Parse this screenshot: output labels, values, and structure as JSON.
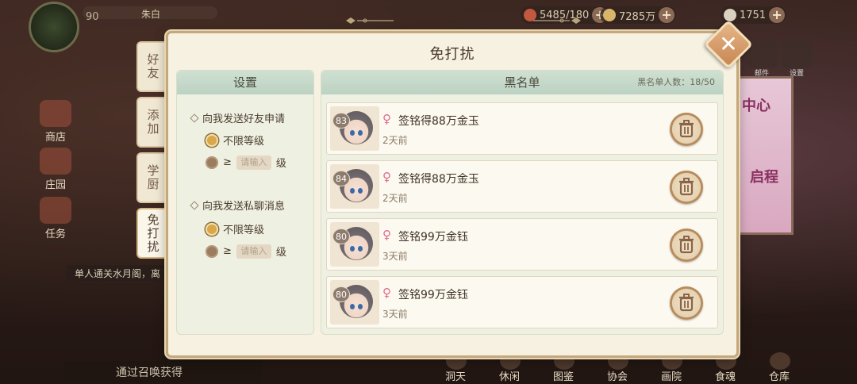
{
  "hud": {
    "player_level": "90",
    "player_name": "朱白",
    "stamina": "5485/180",
    "gold": "7285万",
    "gems": "1751",
    "side_menu": [
      "商店",
      "庄园",
      "任务"
    ],
    "right_menu": [
      "邮件",
      "设置"
    ],
    "poster_text": [
      "中心",
      "启程"
    ],
    "chat_line": "单人通关水月阁，离",
    "recruit_text": "通过召唤获得",
    "bottom_nav": [
      "洞天",
      "休闲",
      "图鉴",
      "协会",
      "画院",
      "食魂",
      "仓库"
    ]
  },
  "modal": {
    "title": "免打扰",
    "tabs": [
      {
        "label": "好友",
        "active": false
      },
      {
        "label": "添加",
        "active": false
      },
      {
        "label": "学厨",
        "active": false
      },
      {
        "label": "免打扰",
        "active": true
      }
    ],
    "settings": {
      "header": "设置",
      "friend_request_label": "向我发送好友申请",
      "private_chat_label": "向我发送私聊消息",
      "option_unlimited": "不限等级",
      "option_ge": "≥",
      "input_placeholder": "请输入",
      "unit": "级"
    },
    "blacklist": {
      "header": "黑名单",
      "count_label": "黑名单人数：18/50",
      "entries": [
        {
          "level": "83",
          "name": "签铭得88万金玉",
          "time": "2天前"
        },
        {
          "level": "84",
          "name": "签铭得88万金玉",
          "time": "2天前"
        },
        {
          "level": "80",
          "name": "签铭99万金钰",
          "time": "3天前"
        },
        {
          "level": "80",
          "name": "签铭99万金钰",
          "time": "3天前"
        }
      ]
    },
    "close_glyph": "✕"
  },
  "colors": {
    "accent": "#c88654",
    "panel_header": "#c7dacb",
    "radio_selected": "#d8a84a",
    "female_icon": "#e06a8e"
  }
}
